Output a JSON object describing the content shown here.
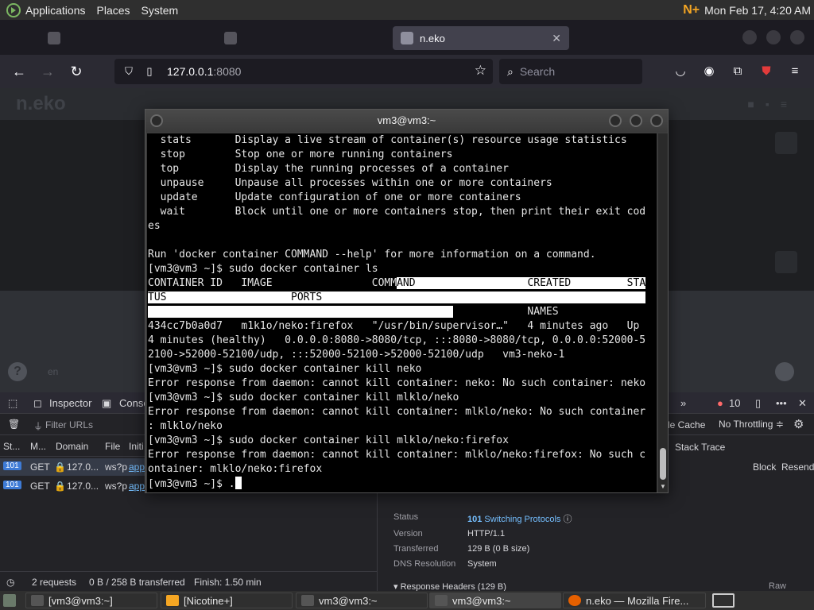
{
  "top_panel": {
    "menus": [
      "Applications",
      "Places",
      "System"
    ],
    "tray_label": "N+",
    "clock": "Mon Feb 17,  4:20 AM"
  },
  "browser": {
    "tabs": [
      {
        "label": "",
        "active": false
      },
      {
        "label": "",
        "active": false
      },
      {
        "label": "n.eko",
        "active": true
      }
    ],
    "url_host": "127.0.0.1",
    "url_port": ":8080",
    "search_placeholder": "Search"
  },
  "page": {
    "logo": "n.eko",
    "lang": "en"
  },
  "terminal": {
    "title": "vm3@vm3:~",
    "lines": [
      "  stats       Display a live stream of container(s) resource usage statistics",
      "  stop        Stop one or more running containers",
      "  top         Display the running processes of a container",
      "  unpause     Unpause all processes within one or more containers",
      "  update      Update configuration of one or more containers",
      "  wait        Block until one or more containers stop, then print their exit cod",
      "es",
      "",
      "Run 'docker container COMMAND --help' for more information on a command.",
      "[vm3@vm3 ~]$ sudo docker container ls",
      "CONTAINER ID   IMAGE                COMMAND                  CREATED         STA",
      "TUS                    PORTS",
      "                                                             NAMES",
      "434cc7b0a0d7   m1k1o/neko:firefox   \"/usr/bin/supervisor…\"   4 minutes ago   Up",
      "4 minutes (healthy)   0.0.0.0:8080->8080/tcp, :::8080->8080/tcp, 0.0.0.0:52000-5",
      "2100->52000-52100/udp, :::52000-52100->52000-52100/udp   vm3-neko-1",
      "[vm3@vm3 ~]$ sudo docker container kill neko",
      "Error response from daemon: cannot kill container: neko: No such container: neko",
      "[vm3@vm3 ~]$ sudo docker container kill mlklo/neko",
      "Error response from daemon: cannot kill container: mlklo/neko: No such container",
      ": mlklo/neko",
      "[vm3@vm3 ~]$ sudo docker container kill mlklo/neko:firefox",
      "Error response from daemon: cannot kill container: mlklo/neko:firefox: No such c",
      "ontainer: mlklo/neko:firefox",
      "[vm3@vm3 ~]$ ."
    ]
  },
  "devtools": {
    "tabs": [
      "Inspector",
      "Conso"
    ],
    "error_count": "10",
    "filter_placeholder": "Filter URLs",
    "cache_label": "le Cache",
    "throttle_label": "No Throttling ≑",
    "columns": [
      "St...",
      "M...",
      "Domain",
      "File",
      "Initi"
    ],
    "rows": [
      {
        "status": "101",
        "method": "GET",
        "domain": "127.0...",
        "file": "ws?p",
        "init": "app"
      },
      {
        "status": "101",
        "method": "GET",
        "domain": "127.0...",
        "file": "ws?p",
        "init": "app"
      }
    ],
    "detail_tab": "Stack Trace",
    "block_label": "Block",
    "resend_label": "Resend",
    "detail": {
      "status_label": "Status",
      "status_code": "101",
      "status_text": "Switching Protocols",
      "version_label": "Version",
      "version": "HTTP/1.1",
      "transferred_label": "Transferred",
      "transferred": "129 B (0 B size)",
      "dns_label": "DNS Resolution",
      "dns": "System",
      "response_headers": "Response Headers (129 B)",
      "raw_label": "Raw"
    },
    "summary": {
      "requests": "2 requests",
      "transferred": "0 B / 258 B transferred",
      "finish": "Finish: 1.50 min"
    }
  },
  "taskbar": {
    "items": [
      "[vm3@vm3:~]",
      "[Nicotine+]",
      "vm3@vm3:~",
      "vm3@vm3:~",
      "n.eko — Mozilla Fire..."
    ]
  }
}
